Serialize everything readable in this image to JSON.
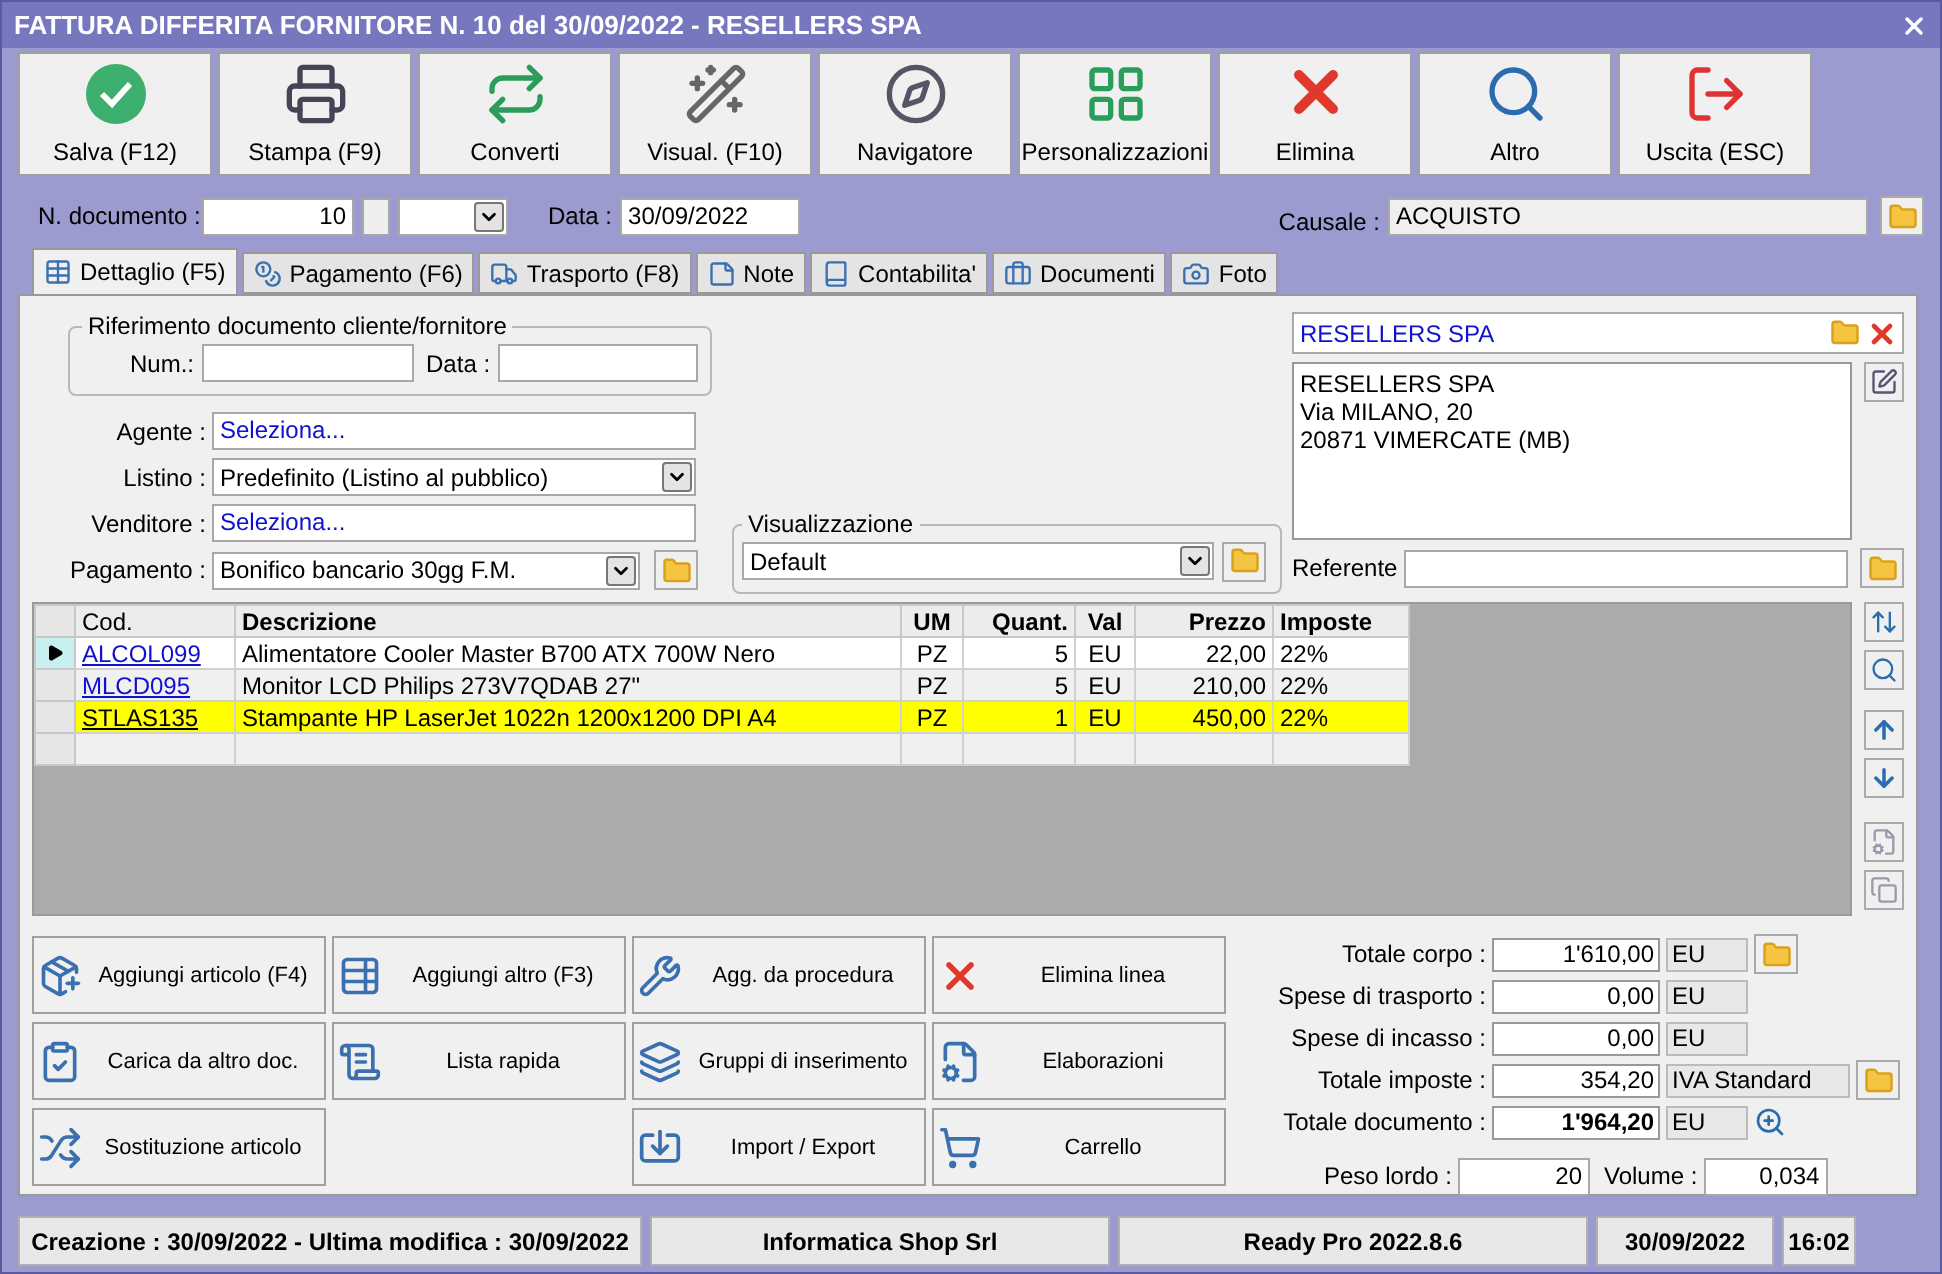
{
  "window": {
    "title": "FATTURA DIFFERITA FORNITORE N. 10 del 30/09/2022 - RESELLERS SPA"
  },
  "toolbar": [
    {
      "label": "Salva (F12)"
    },
    {
      "label": "Stampa (F9)"
    },
    {
      "label": "Converti"
    },
    {
      "label": "Visual. (F10)"
    },
    {
      "label": "Navigatore"
    },
    {
      "label": "Personalizzazioni"
    },
    {
      "label": "Elimina"
    },
    {
      "label": "Altro"
    },
    {
      "label": "Uscita (ESC)"
    }
  ],
  "document": {
    "number_label": "N. documento :",
    "number": "10",
    "date_label": "Data :",
    "date": "30/09/2022",
    "causale_label": "Causale :",
    "causale": "ACQUISTO"
  },
  "tabs": [
    {
      "label": "Dettaglio (F5)",
      "selected": true
    },
    {
      "label": "Pagamento (F6)",
      "selected": false
    },
    {
      "label": "Trasporto (F8)",
      "selected": false
    },
    {
      "label": "Note",
      "selected": false
    },
    {
      "label": "Contabilita'",
      "selected": false
    },
    {
      "label": "Documenti",
      "selected": false
    },
    {
      "label": "Foto",
      "selected": false
    }
  ],
  "reference": {
    "legend": "Riferimento documento cliente/fornitore",
    "num_label": "Num.:",
    "date_label": "Data :"
  },
  "fields": [
    {
      "kind": "link",
      "label": "Agente :",
      "value": "Seleziona..."
    },
    {
      "kind": "select",
      "label": "Listino :",
      "value": "Predefinito (Listino al pubblico)"
    },
    {
      "kind": "link",
      "label": "Venditore :",
      "value": "Seleziona..."
    },
    {
      "kind": "select-folder",
      "label": "Pagamento :",
      "value": "Bonifico bancario 30gg F.M."
    }
  ],
  "view": {
    "legend": "Visualizzazione",
    "value": "Default"
  },
  "supplier": {
    "name": "RESELLERS SPA",
    "address": [
      "RESELLERS SPA",
      "Via MILANO, 20",
      "20871 VIMERCATE (MB)"
    ],
    "contact_label": "Referente"
  },
  "table": {
    "columns": [
      "Cod.",
      "Descrizione",
      "UM",
      "Quant.",
      "Val",
      "Prezzo",
      "Imposte"
    ],
    "rows": [
      {
        "current": true,
        "highlighted": false,
        "cells": [
          "ALCOL099",
          "Alimentatore Cooler Master B700 ATX 700W Nero",
          "PZ",
          "5",
          "EU",
          "22,00",
          "22%"
        ]
      },
      {
        "current": false,
        "highlighted": false,
        "cells": [
          "MLCD095",
          "Monitor LCD Philips 273V7QDAB 27\"",
          "PZ",
          "5",
          "EU",
          "210,00",
          "22%"
        ]
      },
      {
        "current": false,
        "highlighted": true,
        "cells": [
          "STLAS135",
          "Stampante HP LaserJet 1022n 1200x1200 DPI A4",
          "PZ",
          "1",
          "EU",
          "450,00",
          "22%"
        ]
      }
    ]
  },
  "actions": [
    [
      {
        "label": "Aggiungi articolo (F4)"
      },
      {
        "label": "Carica da altro doc."
      },
      {
        "label": "Sostituzione articolo"
      }
    ],
    [
      {
        "label": "Aggiungi altro (F3)"
      },
      {
        "label": "Lista rapida"
      }
    ],
    [
      {
        "label": "Agg. da procedura"
      },
      {
        "label": "Gruppi di inserimento"
      },
      {
        "label": "Import / Export"
      }
    ],
    [
      {
        "label": "Elimina linea"
      },
      {
        "label": "Elaborazioni"
      },
      {
        "label": "Carrello"
      }
    ]
  ],
  "totals": [
    {
      "kind": "folder",
      "label": "Totale corpo :",
      "value": "1'610,00",
      "unit": "EU",
      "bold": false
    },
    {
      "kind": "plain",
      "label": "Spese di trasporto :",
      "value": "0,00",
      "unit": "EU",
      "bold": false
    },
    {
      "kind": "plain",
      "label": "Spese di incasso :",
      "value": "0,00",
      "unit": "EU",
      "bold": false
    },
    {
      "kind": "folder-wide",
      "label": "Totale imposte :",
      "value": "354,20",
      "unit": "IVA Standard",
      "bold": false
    },
    {
      "kind": "zoom",
      "label": "Totale documento :",
      "value": "1'964,20",
      "unit": "EU",
      "bold": true
    }
  ],
  "weight": {
    "label": "Peso lordo :",
    "value": "20",
    "volume_label": "Volume :",
    "volume": "0,034"
  },
  "status_bar": [
    "Creazione : 30/09/2022 - Ultima modifica : 30/09/2022",
    "Informatica Shop Srl",
    "Ready Pro 2022.8.6",
    "30/09/2022",
    "16:02"
  ]
}
